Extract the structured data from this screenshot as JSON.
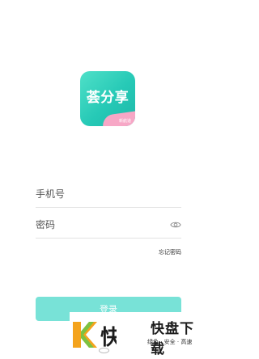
{
  "logo": {
    "name": "荟分享",
    "badge": "新航道"
  },
  "form": {
    "phone_placeholder": "手机号",
    "password_placeholder": "密码",
    "forgot_password": "忘记密码",
    "login_label": "登录"
  },
  "watermark": {
    "title": "快盘下载",
    "slogan": "绿色 · 安全 · 高速"
  },
  "colors": {
    "accent": "#26c9b6",
    "button": "#78e2d7"
  }
}
